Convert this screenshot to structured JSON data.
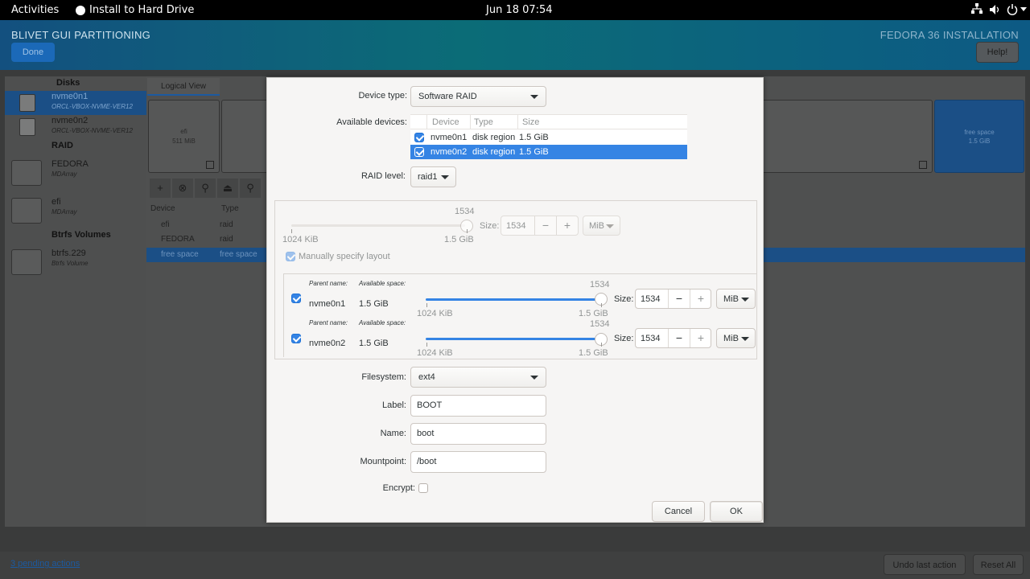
{
  "topbar": {
    "activities": "Activities",
    "app": "Install to Hard Drive",
    "clock": "Jun 18  07:54",
    "icons": [
      "network-icon",
      "volume-icon",
      "power-icon"
    ]
  },
  "banner": {
    "title": "BLIVET GUI PARTITIONING",
    "done": "Done",
    "right_title": "FEDORA 36 INSTALLATION",
    "help": "Help!"
  },
  "sidebar": {
    "disks_header": "Disks",
    "disks": [
      {
        "name": "nvme0n1",
        "sub": "ORCL-VBOX-NVME-VER12"
      },
      {
        "name": "nvme0n2",
        "sub": "ORCL-VBOX-NVME-VER12"
      }
    ],
    "raid_header": "RAID",
    "raid": [
      {
        "name": "FEDORA",
        "sub": "MDArray"
      },
      {
        "name": "efi",
        "sub": "MDArray"
      }
    ],
    "btrfs_header": "Btrfs Volumes",
    "btrfs": [
      {
        "name": "btrfs.229",
        "sub": "Btrfs Volume"
      }
    ]
  },
  "main": {
    "tab": "Logical View",
    "blocks": [
      {
        "name": "efi",
        "size": "511 MiB"
      },
      {
        "name": "free space",
        "size": "1.5 GiB"
      }
    ],
    "table_headers": [
      "Device",
      "Type"
    ],
    "rows": [
      {
        "device": "efi",
        "type": "raid"
      },
      {
        "device": "FEDORA",
        "type": "raid"
      },
      {
        "device": "free space",
        "type": "free space"
      }
    ]
  },
  "bottom": {
    "pending": "3 pending actions",
    "undo": "Undo last action",
    "reset": "Reset All"
  },
  "dialog": {
    "device_type_label": "Device type:",
    "device_type": "Software RAID",
    "available_label": "Available devices:",
    "dev_headers": [
      "Device",
      "Type",
      "Size"
    ],
    "devices": [
      {
        "device": "nvme0n1",
        "type": "disk region",
        "size": "1.5 GiB",
        "checked": true
      },
      {
        "device": "nvme0n2",
        "type": "disk region",
        "size": "1.5 GiB",
        "checked": true
      }
    ],
    "raid_level_label": "RAID level:",
    "raid_level": "raid1",
    "global": {
      "max": "1534",
      "min_label": "1024 KiB",
      "max_label": "1.5 GiB",
      "size_label": "Size:",
      "value": "1534",
      "unit": "MiB"
    },
    "manual_label": "Manually specify layout",
    "parents": [
      {
        "parent_label": "Parent name:",
        "avail_label": "Available space:",
        "name": "nvme0n1",
        "space": "1.5 GiB",
        "max": "1534",
        "min_label": "1024 KiB",
        "max_label": "1.5 GiB",
        "size_label": "Size:",
        "value": "1534",
        "unit": "MiB"
      },
      {
        "parent_label": "Parent name:",
        "avail_label": "Available space:",
        "name": "nvme0n2",
        "space": "1.5 GiB",
        "max": "1534",
        "min_label": "1024 KiB",
        "max_label": "1.5 GiB",
        "size_label": "Size:",
        "value": "1534",
        "unit": "MiB"
      }
    ],
    "filesystem_label": "Filesystem:",
    "filesystem": "ext4",
    "label_label": "Label:",
    "label_value": "BOOT",
    "name_label": "Name:",
    "name_value": "boot",
    "mount_label": "Mountpoint:",
    "mount_value": "/boot",
    "encrypt_label": "Encrypt:",
    "encrypt": false,
    "cancel": "Cancel",
    "ok": "OK"
  },
  "colors": {
    "accent": "#3584e4",
    "selection": "#1c71d8",
    "banner_start": "#13507f",
    "banner_end": "#0d5a84"
  }
}
